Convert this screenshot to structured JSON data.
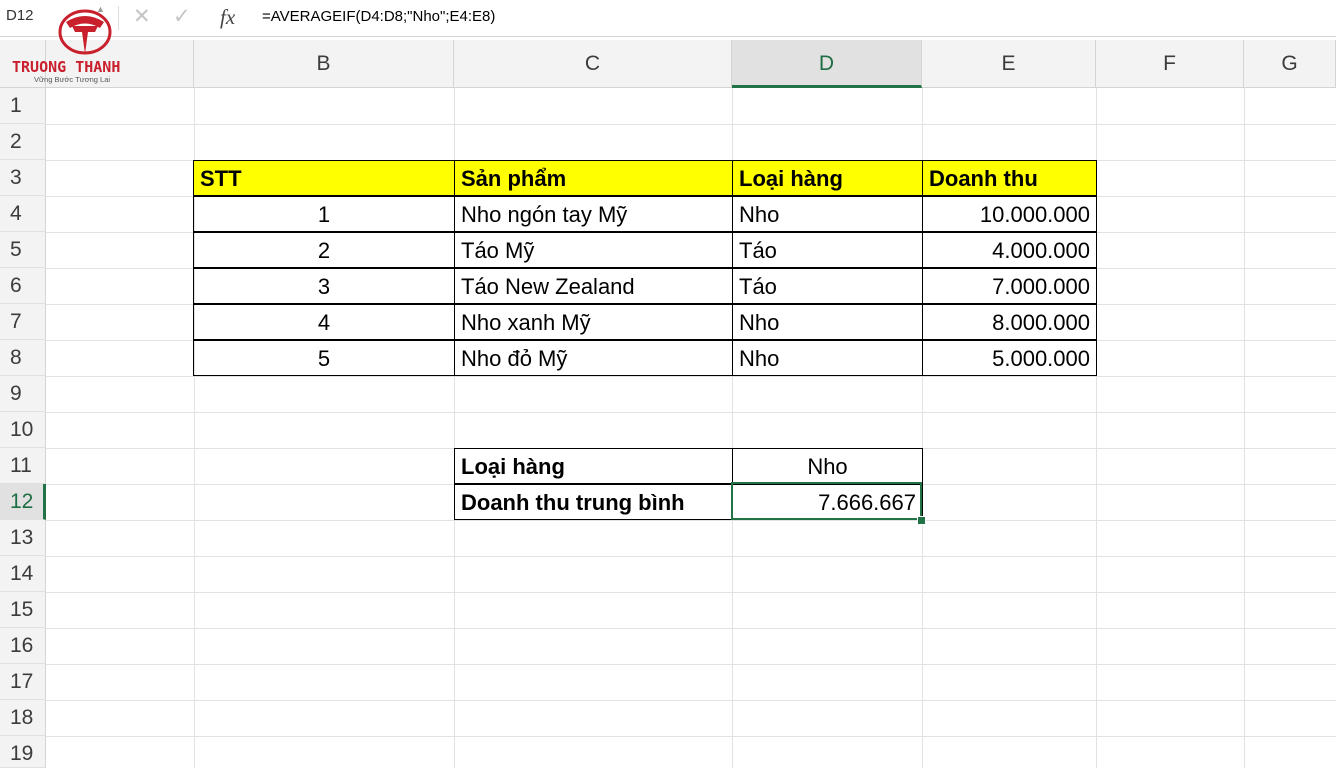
{
  "formula_bar": {
    "name_box": "D12",
    "fx_label": "fx",
    "formula": "=AVERAGEIF(D4:D8;\"Nho\";E4:E8)"
  },
  "logo": {
    "title": "TRUONG THANH",
    "subtitle": "Vững Bước Tương Lai"
  },
  "colors": {
    "accent": "#217346",
    "header_fill": "#ffff00",
    "logo_red": "#c8202d"
  },
  "columns": [
    "B",
    "C",
    "D",
    "E",
    "F",
    "G"
  ],
  "rows": [
    "1",
    "2",
    "3",
    "4",
    "5",
    "6",
    "7",
    "8",
    "9",
    "10",
    "11",
    "12",
    "13",
    "14",
    "15",
    "16",
    "17",
    "18",
    "19"
  ],
  "table": {
    "headers": [
      "STT",
      "Sản phẩm",
      "Loại hàng",
      "Doanh thu"
    ],
    "rows": [
      [
        "1",
        "Nho ngón tay Mỹ",
        "Nho",
        "10.000.000"
      ],
      [
        "2",
        "Táo Mỹ",
        "Táo",
        "4.000.000"
      ],
      [
        "3",
        "Táo New Zealand",
        "Táo",
        "7.000.000"
      ],
      [
        "4",
        "Nho xanh Mỹ",
        "Nho",
        "8.000.000"
      ],
      [
        "5",
        "Nho đỏ Mỹ",
        "Nho",
        "5.000.000"
      ]
    ]
  },
  "summary": {
    "type_label": "Loại hàng",
    "type_value": "Nho",
    "avg_label": "Doanh thu trung bình",
    "avg_value": "7.666.667"
  },
  "active_cell": "D12"
}
